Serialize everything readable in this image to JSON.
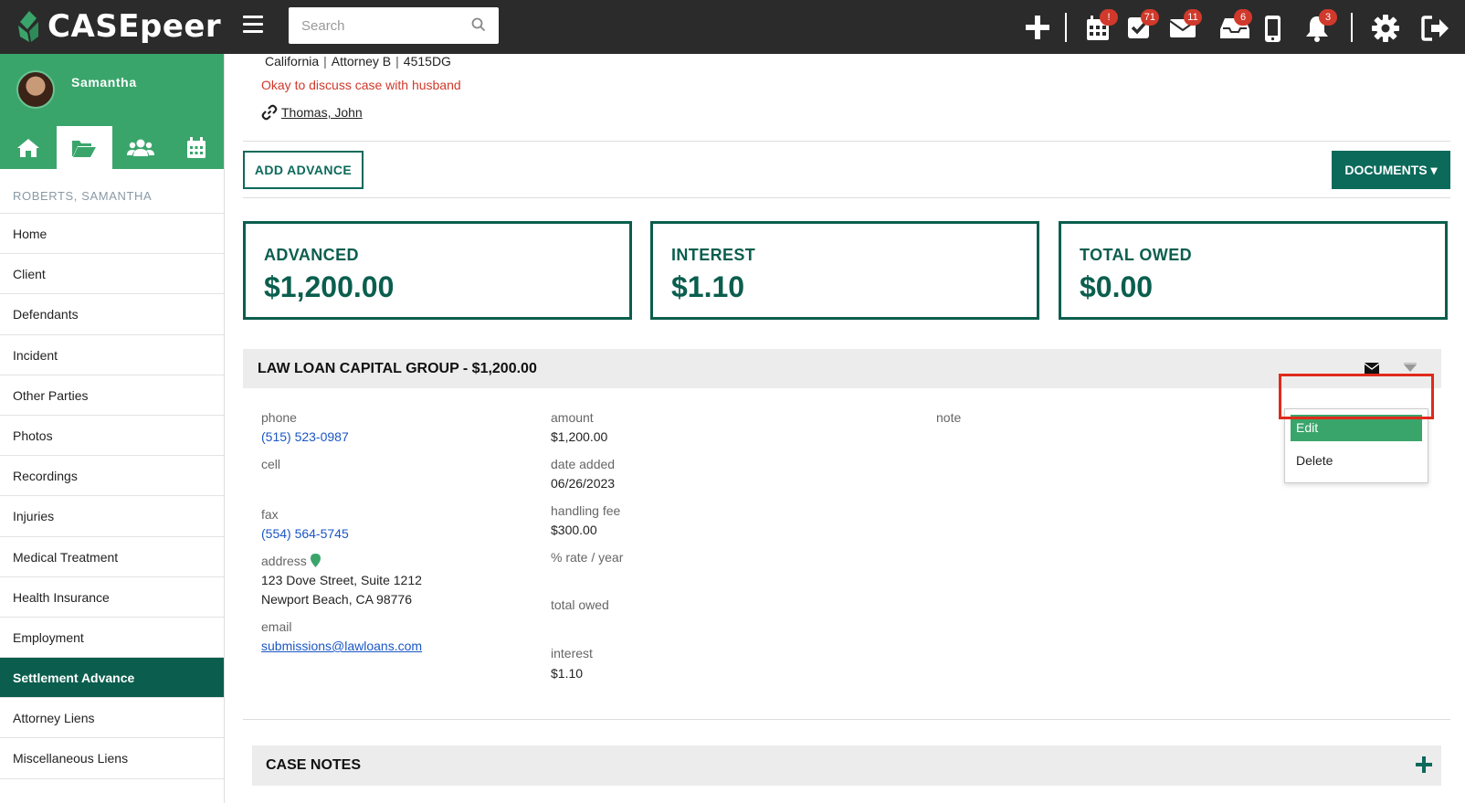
{
  "app": {
    "logo_text": "CASEpeer"
  },
  "search": {
    "placeholder": "Search"
  },
  "topbar": {
    "badges": {
      "calendar": "!",
      "tasks": "71",
      "mail": "11",
      "inbox": "6",
      "notifications": "3"
    }
  },
  "sidebar": {
    "username": "Samantha",
    "client_name": "ROBERTS, SAMANTHA",
    "items": [
      {
        "label": "Home"
      },
      {
        "label": "Client"
      },
      {
        "label": "Defendants"
      },
      {
        "label": "Incident"
      },
      {
        "label": "Other Parties"
      },
      {
        "label": "Photos"
      },
      {
        "label": "Recordings"
      },
      {
        "label": "Injuries"
      },
      {
        "label": "Medical Treatment"
      },
      {
        "label": "Health Insurance"
      },
      {
        "label": "Employment"
      },
      {
        "label": "Settlement Advance"
      },
      {
        "label": "Attorney Liens"
      },
      {
        "label": "Miscellaneous Liens"
      }
    ]
  },
  "case_header": {
    "state": "California",
    "attorney": "Attorney B",
    "case_code": "4515DG",
    "warning": "Okay to discuss case with husband",
    "linked_contact": "Thomas, John"
  },
  "actions": {
    "add_advance": "ADD ADVANCE",
    "documents": "DOCUMENTS ▾"
  },
  "stats": {
    "advanced_label": "ADVANCED",
    "advanced_value": "$1,200.00",
    "interest_label": "INTEREST",
    "interest_value": "$1.10",
    "total_owed_label": "TOTAL OWED",
    "total_owed_value": "$0.00"
  },
  "lender": {
    "title": "LAW LOAN CAPITAL GROUP - $1,200.00",
    "phone_label": "phone",
    "phone": "(515) 523-0987",
    "cell_label": "cell",
    "fax_label": "fax",
    "fax": "(554) 564-5745",
    "address_label": "address",
    "address_line1": "123 Dove Street, Suite 1212",
    "address_line2": "Newport Beach, CA 98776",
    "email_label": "email",
    "email": "submissions@lawloans.com ",
    "amount_label": "amount",
    "amount": "$1,200.00",
    "date_added_label": "date added",
    "date_added": "06/26/2023",
    "handling_fee_label": "handling fee",
    "handling_fee": "$300.00",
    "rate_label": "% rate / year",
    "total_owed_label": "total owed",
    "interest_label": "interest",
    "interest": "$1.10",
    "note_label": "note"
  },
  "dropdown": {
    "edit": "Edit",
    "delete": "Delete"
  },
  "case_notes": {
    "title": "CASE NOTES"
  },
  "colors": {
    "brand_green": "#3aa56b",
    "dark_teal": "#0b5e4e",
    "topbar": "#2b2b2b",
    "warning": "#d0392b",
    "link": "#1a56c4"
  }
}
